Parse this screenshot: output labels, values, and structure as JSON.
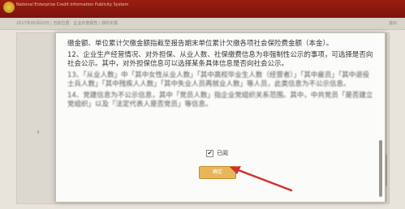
{
  "header": {
    "site_title": "National Enterprise Credit Information Publicity System",
    "breadcrumb": "2017年05月02日 | 当前位置：企业年度报告 | 我的年报",
    "right_text": "退出"
  },
  "background": {
    "marker": "4"
  },
  "dialog": {
    "paragraphs": [
      {
        "text": "缴金额、单位累计欠缴金额指截至报告期末单位累计欠缴各项社会保险费金额（本金）。",
        "blurred": false
      },
      {
        "text": "12、企业生产经营情况、对外担保、从业人数、社保缴费信息为非强制性公示的事项，可选择是否向社会公示。其中，对外担保信息可以选择某条具体信息是否向社会公示。",
        "blurred": false
      },
      {
        "text": "13、「从业人数」中「其中女性从业人数」「其中高校毕业生人数（经营者）」「其中雇员」「其中退役士兵人数」「其中残疾人人数」「其中失业人员再就业人数」等人员，此类信息为不公示信息。",
        "blurred": true
      },
      {
        "text": "14、党建信息为不公示信息，其中「党员人数」指企业党组织关系范围。其中，中共党员「是否建立党组织」以及「法定代表人是否党员」等信息。",
        "blurred": true
      }
    ],
    "agree_checkbox_mark": "✔",
    "agree_label": "已阅",
    "ok_button": "确定"
  },
  "colors": {
    "header": "#8b1a10",
    "ok_button": "#e8b55a",
    "arrow": "#d0312d"
  },
  "icons": {
    "emblem": "national-emblem-icon",
    "arrow": "red-arrow-annotation"
  }
}
